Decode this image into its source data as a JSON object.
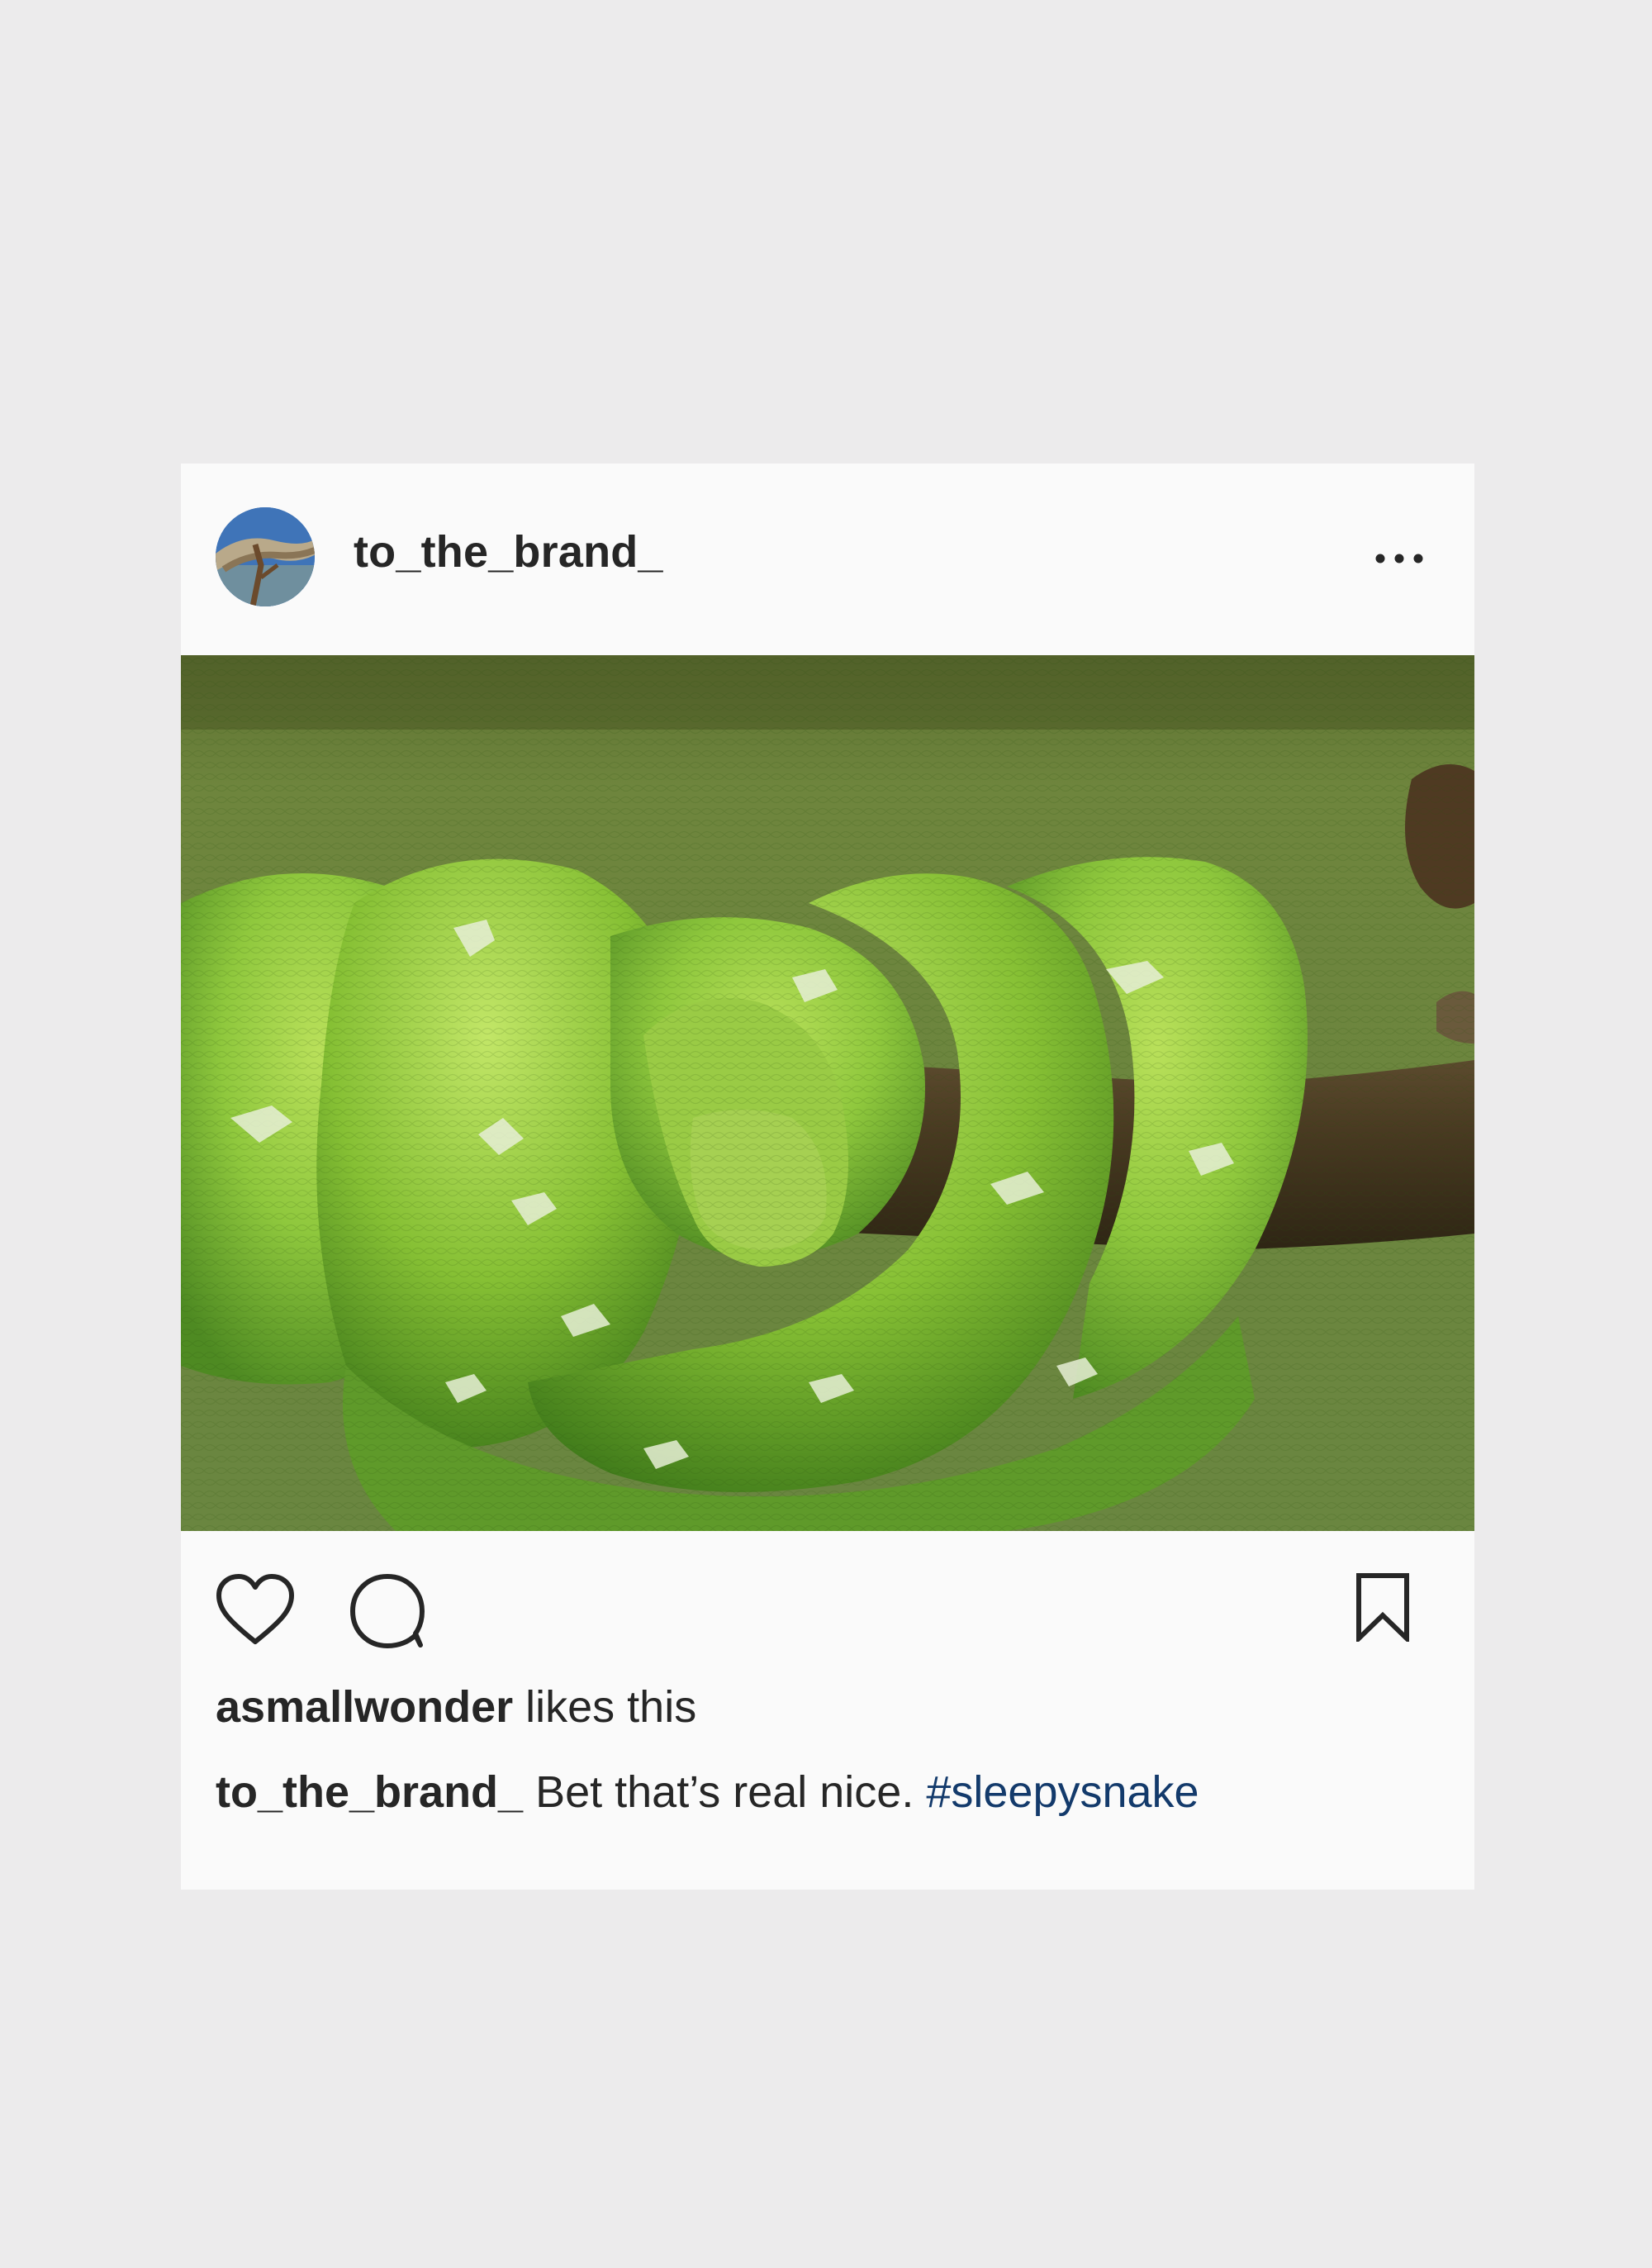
{
  "post": {
    "author": "to_the_brand_",
    "more_icon": "more-horizontal-icon",
    "photo_subject": "green tree python coiled on a branch",
    "actions": {
      "like_icon": "heart-icon",
      "comment_icon": "comment-icon",
      "save_icon": "bookmark-icon"
    },
    "likes": {
      "user": "asmallwonder",
      "text": " likes this"
    },
    "caption": {
      "user": "to_the_brand_",
      "text": " Bet that’s real nice. ",
      "hashtag": "#sleepysnake"
    }
  },
  "colors": {
    "background": "#ecebec",
    "card": "#fafafa",
    "text": "#262626",
    "hashtag": "#133a6b",
    "snake_green": "#8cc63c"
  }
}
